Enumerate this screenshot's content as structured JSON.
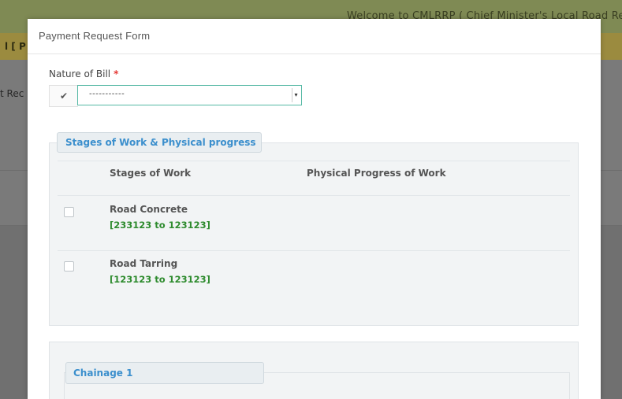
{
  "background": {
    "welcome_text": "Welcome to CMLRRP ( Chief Minister's Local Road Reb",
    "yellow_bar_text": "l [ P",
    "side_text": "t Rec"
  },
  "modal": {
    "title": "Payment Request Form",
    "nature_of_bill": {
      "label": "Nature of Bill",
      "required_mark": "*",
      "check_icon": "✔",
      "selected_value": "-----------",
      "arrow": "▾"
    },
    "stages_section": {
      "title": "Stages of Work & Physical progress",
      "columns": [
        "Stages of Work",
        "Physical Progress of Work"
      ],
      "rows": [
        {
          "name": "Road Concrete",
          "range": "[233123 to 123123]"
        },
        {
          "name": "Road Tarring",
          "range": "[123123 to 123123]"
        }
      ]
    },
    "chainage_section": {
      "title": "Chainage 1"
    }
  }
}
